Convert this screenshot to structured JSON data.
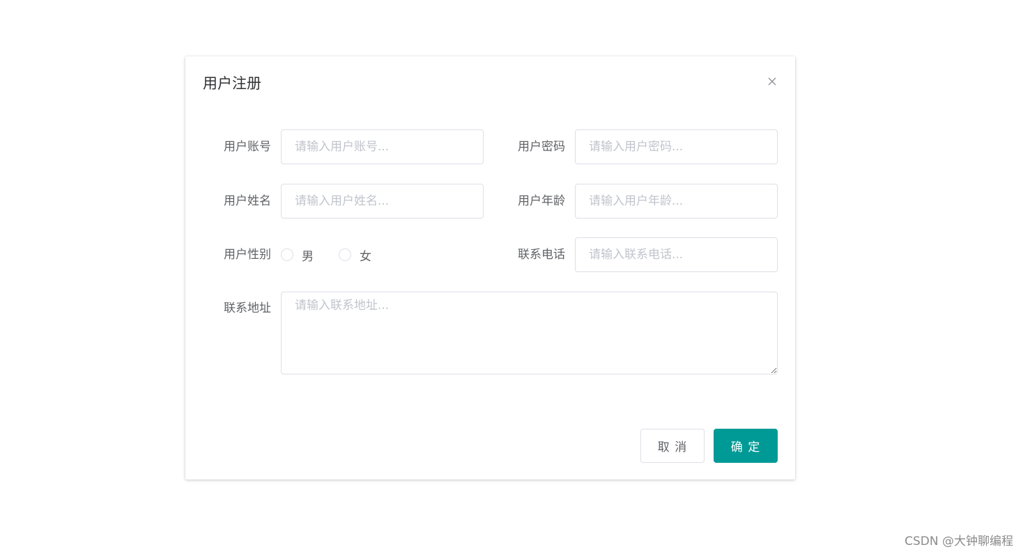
{
  "dialog": {
    "title": "用户注册",
    "fields": {
      "account": {
        "label": "用户账号",
        "placeholder": "请输入用户账号..."
      },
      "password": {
        "label": "用户密码",
        "placeholder": "请输入用户密码..."
      },
      "name": {
        "label": "用户姓名",
        "placeholder": "请输入用户姓名..."
      },
      "age": {
        "label": "用户年龄",
        "placeholder": "请输入用户年龄..."
      },
      "gender": {
        "label": "用户性别",
        "options": [
          "男",
          "女"
        ]
      },
      "phone": {
        "label": "联系电话",
        "placeholder": "请输入联系电话..."
      },
      "address": {
        "label": "联系地址",
        "placeholder": "请输入联系地址..."
      }
    },
    "buttons": {
      "cancel": "取 消",
      "confirm": "确 定"
    },
    "icons": {
      "close": "close-icon"
    },
    "colors": {
      "primary": "#009a96"
    }
  },
  "watermark": "CSDN @大钟聊编程"
}
